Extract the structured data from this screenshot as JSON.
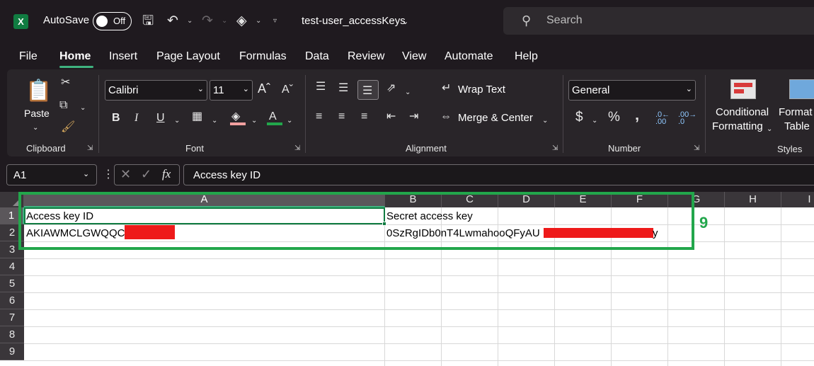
{
  "titlebar": {
    "autosave_label": "AutoSave",
    "autosave_state": "Off",
    "document_title": "test-user_accessKeys",
    "search_placeholder": "Search"
  },
  "menu": {
    "tabs": [
      "File",
      "Home",
      "Insert",
      "Page Layout",
      "Formulas",
      "Data",
      "Review",
      "View",
      "Automate",
      "Help"
    ],
    "active": "Home"
  },
  "ribbon": {
    "clipboard": {
      "label": "Clipboard",
      "paste_label": "Paste"
    },
    "font": {
      "label": "Font",
      "font_name": "Calibri",
      "font_size": "11"
    },
    "alignment": {
      "label": "Alignment",
      "wrap_text": "Wrap Text",
      "merge_center": "Merge & Center"
    },
    "number": {
      "label": "Number",
      "format": "General",
      "currency": "$",
      "percent": "%",
      "comma": "‚",
      "inc_decimal": ".0←\n.00",
      "dec_decimal": ".00→\n.0"
    },
    "styles": {
      "label": "Styles",
      "conditional_line1": "Conditional",
      "conditional_line2": "Formatting",
      "format_table_line1": "Format",
      "format_table_line2": "Table"
    }
  },
  "formula_bar": {
    "name_box": "A1",
    "fx": "fx",
    "content": "Access key ID"
  },
  "grid": {
    "columns": [
      "A",
      "B",
      "C",
      "D",
      "E",
      "F",
      "G",
      "H",
      "I"
    ],
    "rows": [
      "1",
      "2",
      "3",
      "4",
      "5",
      "6",
      "7",
      "8",
      "9"
    ],
    "cells": {
      "A1": "Access key ID",
      "B1": "Secret access key",
      "A2": "AKIAWMCLGWQQC",
      "B2": "0SzRgIDb0nT4LwmahooQFyAU",
      "B2_tail": "y"
    },
    "selected_cell": "A1"
  },
  "annotation": {
    "number": "9",
    "color": "#22a64b"
  },
  "colors": {
    "accent_green": "#107c41",
    "redaction": "#ee1a1a"
  }
}
